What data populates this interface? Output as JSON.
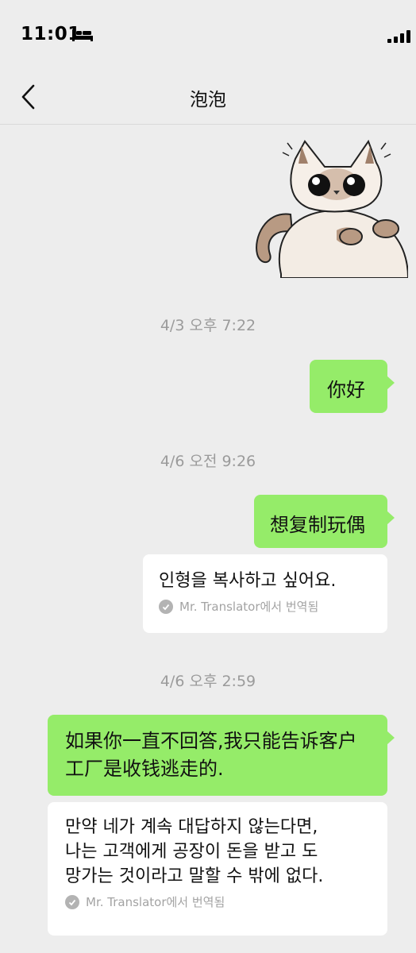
{
  "status_bar": {
    "time": "11:01"
  },
  "header": {
    "title": "泡泡"
  },
  "messages": {
    "ts1": "4/3 오후 7:22",
    "msg1": "你好",
    "ts2": "4/6 오전 9:26",
    "msg2": "想复制玩偶",
    "trans2": "인형을 복사하고 싶어요.",
    "ts3": "4/6 오후 2:59",
    "msg3_line1": "如果你一直不回答,我只能告诉客户",
    "msg3_line2": "工厂是收钱逃走的.",
    "trans3_line1": "만약 네가 계속 대답하지 않는다면,",
    "trans3_line2": "나는 고객에게 공장이 돈을 받고 도",
    "trans3_line3": "망가는 것이라고 말할 수 밖에 없다."
  },
  "translation_footer": "Mr. Translator에서 번역됨",
  "colors": {
    "bg": "#ededed",
    "my_bubble": "#95ec69",
    "card": "#ffffff",
    "muted": "#9b9b9b"
  },
  "icons": [
    "bed-icon",
    "signal-icon",
    "back-chevron-icon",
    "check-icon"
  ]
}
